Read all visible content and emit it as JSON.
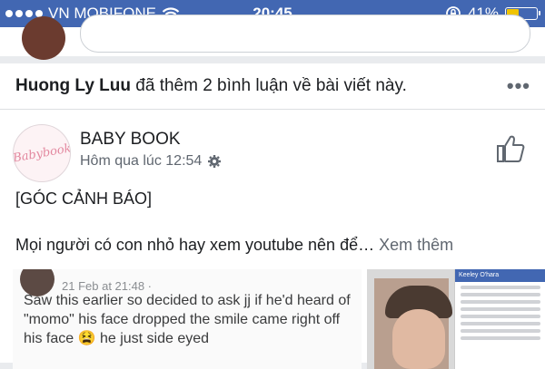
{
  "status": {
    "carrier": "VN MOBIFONE",
    "time": "20:45",
    "battery": "41%",
    "battery_level": 0.41,
    "accent": "#4267b2"
  },
  "notification": {
    "user": "Huong Ly Luu",
    "action": " đã thêm 2 bình luận về bài viết này.",
    "more_icon": "more-icon"
  },
  "post": {
    "page_name": "BABY BOOK",
    "time": "Hôm qua lúc 12:54",
    "avatar_text": "Babybook",
    "tag": "[GÓC CẢNH BÁO]",
    "body": "Mọi người có con nhỏ hay xem youtube nên để…",
    "see_more": "Xem thêm",
    "embed": {
      "date": "21 Feb at 21:48 · ",
      "text": "Saw this earlier so decided to ask jj if he'd heard of \"momo\" his face dropped the smile came right off his face 😫 he just side eyed"
    },
    "side_photo_header": "Keeley O'hara"
  }
}
